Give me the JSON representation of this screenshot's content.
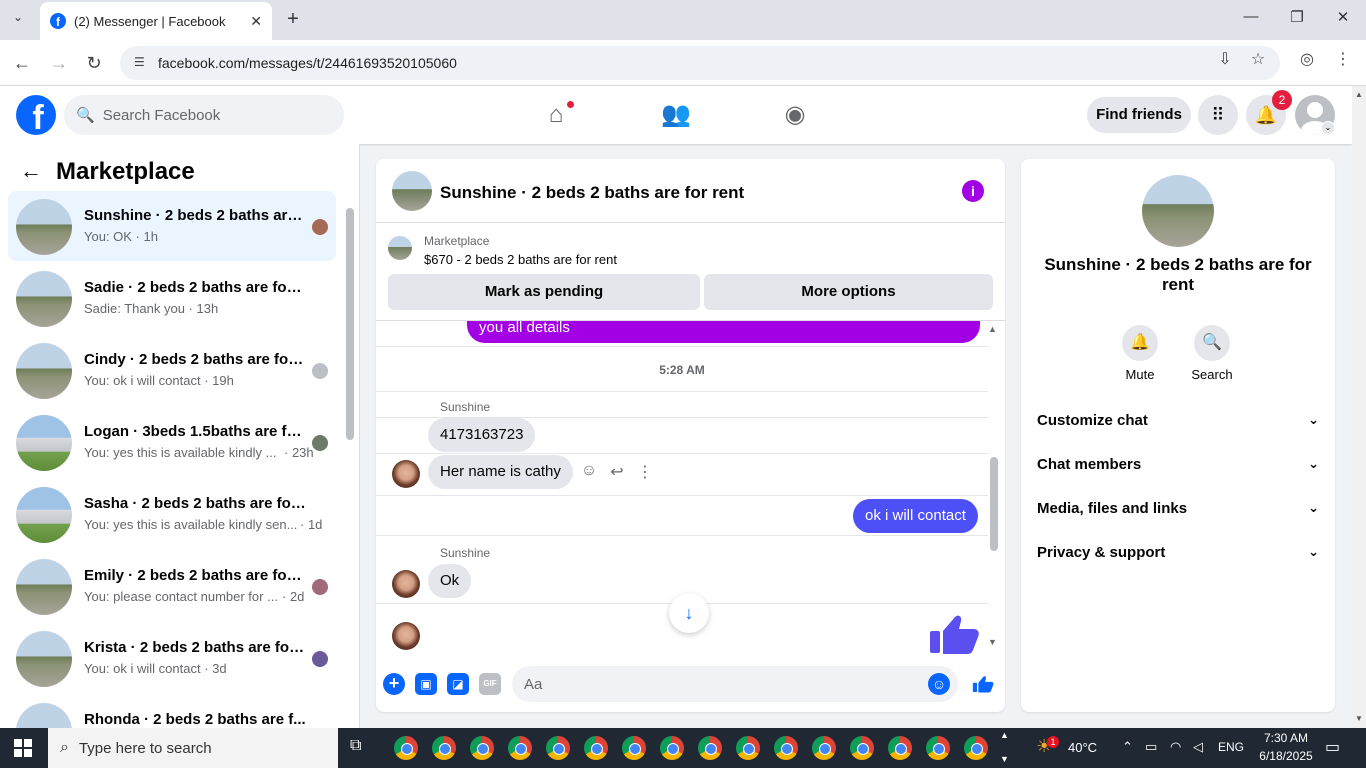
{
  "browser": {
    "tab_title": "(2) Messenger | Facebook",
    "tab_icon": "facebook-icon",
    "url": "facebook.com/messages/t/24461693520105060"
  },
  "header": {
    "search_placeholder": "Search Facebook",
    "find_friends": "Find friends",
    "notification_count": "2"
  },
  "sidebar": {
    "title": "Marketplace",
    "conversations": [
      {
        "name": "Sunshine · 2 beds 2 baths are ...",
        "preview": "You: OK · 1h",
        "active": true
      },
      {
        "name": "Sadie · 2 beds 2 baths are for rent",
        "preview": "Sadie: Thank you · 13h"
      },
      {
        "name": "Cindy · 2 beds 2 baths are for ...",
        "preview": "You: ok i will contact · 19h"
      },
      {
        "name": "Logan · 3beds 1.5baths are for...",
        "preview": "You: yes this is available kindly ...",
        "time": "· 23h"
      },
      {
        "name": "Sasha · 2 beds 2 baths are for rent",
        "preview": "You: yes this is available kindly sen...",
        "time": "· 1d"
      },
      {
        "name": "Emily · 2 beds 2 baths are for ...",
        "preview": "You: please contact number for ...",
        "time": "· 2d"
      },
      {
        "name": "Krista · 2 beds 2 baths are for ...",
        "preview": "You: ok i will contact · 3d"
      },
      {
        "name": "Rhonda · 2 beds 2 baths are f...",
        "preview": ""
      }
    ]
  },
  "chat": {
    "title": "Sunshine · 2 beds 2 baths are for rent",
    "marketplace_label": "Marketplace",
    "listing": "$670 - 2 beds 2 baths are for rent",
    "mark_pending": "Mark as pending",
    "more_options": "More options",
    "partial_message": "you all details",
    "timestamp": "5:28 AM",
    "sender": "Sunshine",
    "msg_phone": "4173163723",
    "msg_name": "Her name is cathy",
    "msg_me": "ok i will contact",
    "msg_ok": "Ok",
    "input_placeholder": "Aa"
  },
  "details": {
    "name": "Sunshine · 2 beds 2 baths are for rent",
    "mute": "Mute",
    "search": "Search",
    "sections": [
      "Customize chat",
      "Chat members",
      "Media, files and links",
      "Privacy & support"
    ]
  },
  "taskbar": {
    "search_placeholder": "Type here to search",
    "weather": "40°C",
    "weather_badge": "1",
    "language": "ENG",
    "time": "7:30 AM",
    "date": "6/18/2025"
  }
}
